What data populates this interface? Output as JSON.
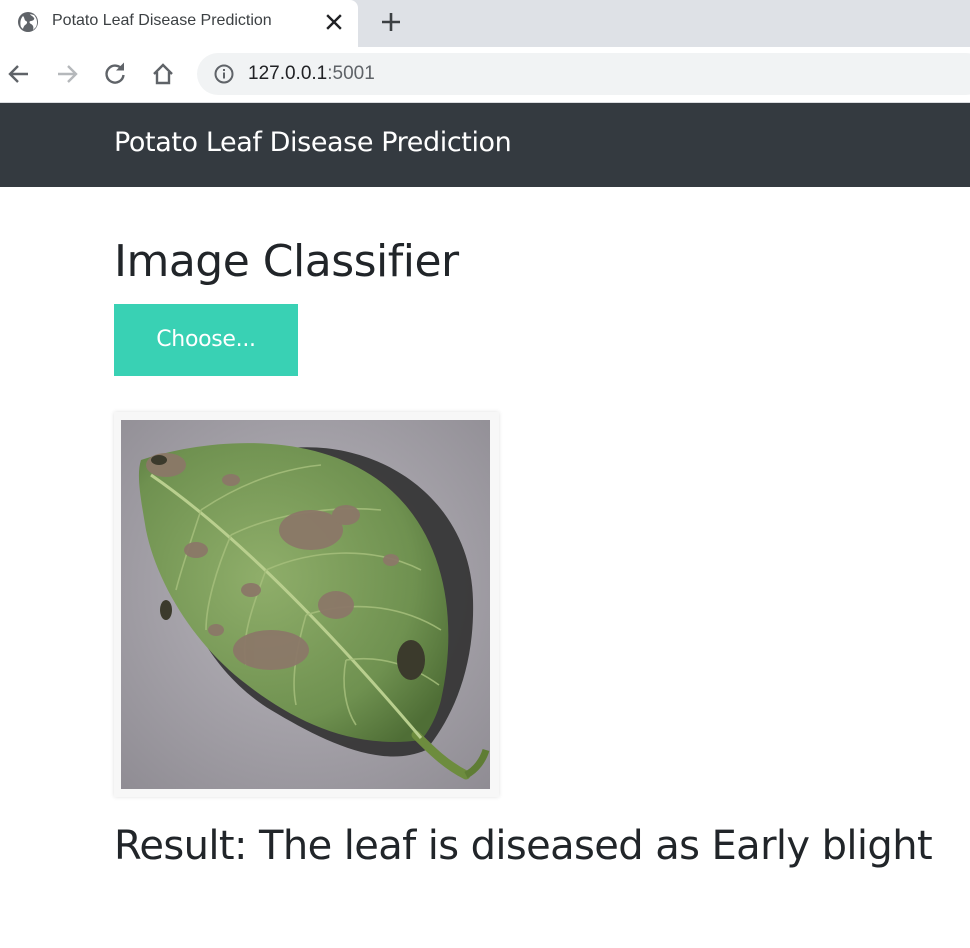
{
  "browser": {
    "tab_title": "Potato Leaf Disease Prediction",
    "url_host": "127.0.0.1",
    "url_port": ":5001",
    "icons": [
      "globe-icon",
      "close-icon",
      "plus-icon",
      "back-arrow-icon",
      "forward-arrow-icon",
      "reload-icon",
      "home-icon",
      "info-icon"
    ]
  },
  "navbar": {
    "brand": "Potato Leaf Disease Prediction"
  },
  "main": {
    "heading": "Image Classifier",
    "upload_label": "Choose...",
    "preview_image_alt": "potato leaf",
    "result_text": "Result: The leaf is diseased as Early blight"
  },
  "colors": {
    "navbar_bg": "#343a40",
    "button_bg": "#39d1b4",
    "text": "#212529"
  }
}
